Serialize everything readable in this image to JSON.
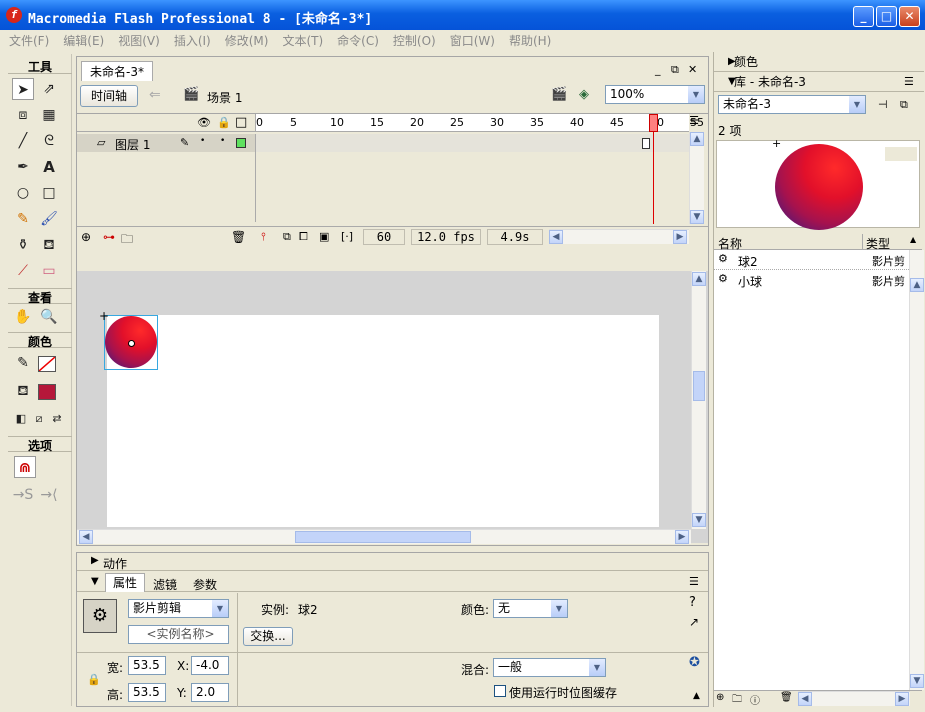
{
  "window": {
    "title": "Macromedia Flash Professional 8 - [未命名-3*]"
  },
  "menu": [
    "文件(F)",
    "编辑(E)",
    "视图(V)",
    "插入(I)",
    "修改(M)",
    "文本(T)",
    "命令(C)",
    "控制(O)",
    "窗口(W)",
    "帮助(H)"
  ],
  "toolbox": {
    "tools_label": "工具",
    "view_label": "查看",
    "colors_label": "颜色",
    "options_label": "选项"
  },
  "document": {
    "tab": "未命名-3*",
    "timeline_button": "时间轴",
    "scene": "场景 1",
    "zoom": "100%"
  },
  "timeline": {
    "ruler": [
      "5",
      "10",
      "15",
      "20",
      "25",
      "30",
      "35",
      "40",
      "45",
      "50",
      "55",
      "60"
    ],
    "layer_name": "图层 1",
    "frame": "60",
    "fps": "12.0 fps",
    "time": "4.9s"
  },
  "properties": {
    "panel_actions": "动作",
    "tabs": [
      "属性",
      "滤镜",
      "参数"
    ],
    "symbol_type": "影片剪辑",
    "instance_name_placeholder": "<实例名称>",
    "instance_label": "实例:",
    "instance_value": "球2",
    "swap_button": "交换...",
    "color_label": "颜色:",
    "color_value": "无",
    "width_label": "宽:",
    "width_value": "53.5",
    "height_label": "高:",
    "height_value": "53.5",
    "x_label": "X:",
    "x_value": "-4.0",
    "y_label": "Y:",
    "y_value": "2.0",
    "blend_label": "混合:",
    "blend_value": "一般",
    "cache_label": "使用运行时位图缓存"
  },
  "library": {
    "color_panel": "颜色",
    "title": "库 - 未命名-3",
    "doc_select": "未命名-3",
    "count": "2 项",
    "col_name": "名称",
    "col_type": "类型",
    "items": [
      {
        "name": "球2",
        "type": "影片剪"
      },
      {
        "name": "小球",
        "type": "影片剪"
      }
    ]
  }
}
